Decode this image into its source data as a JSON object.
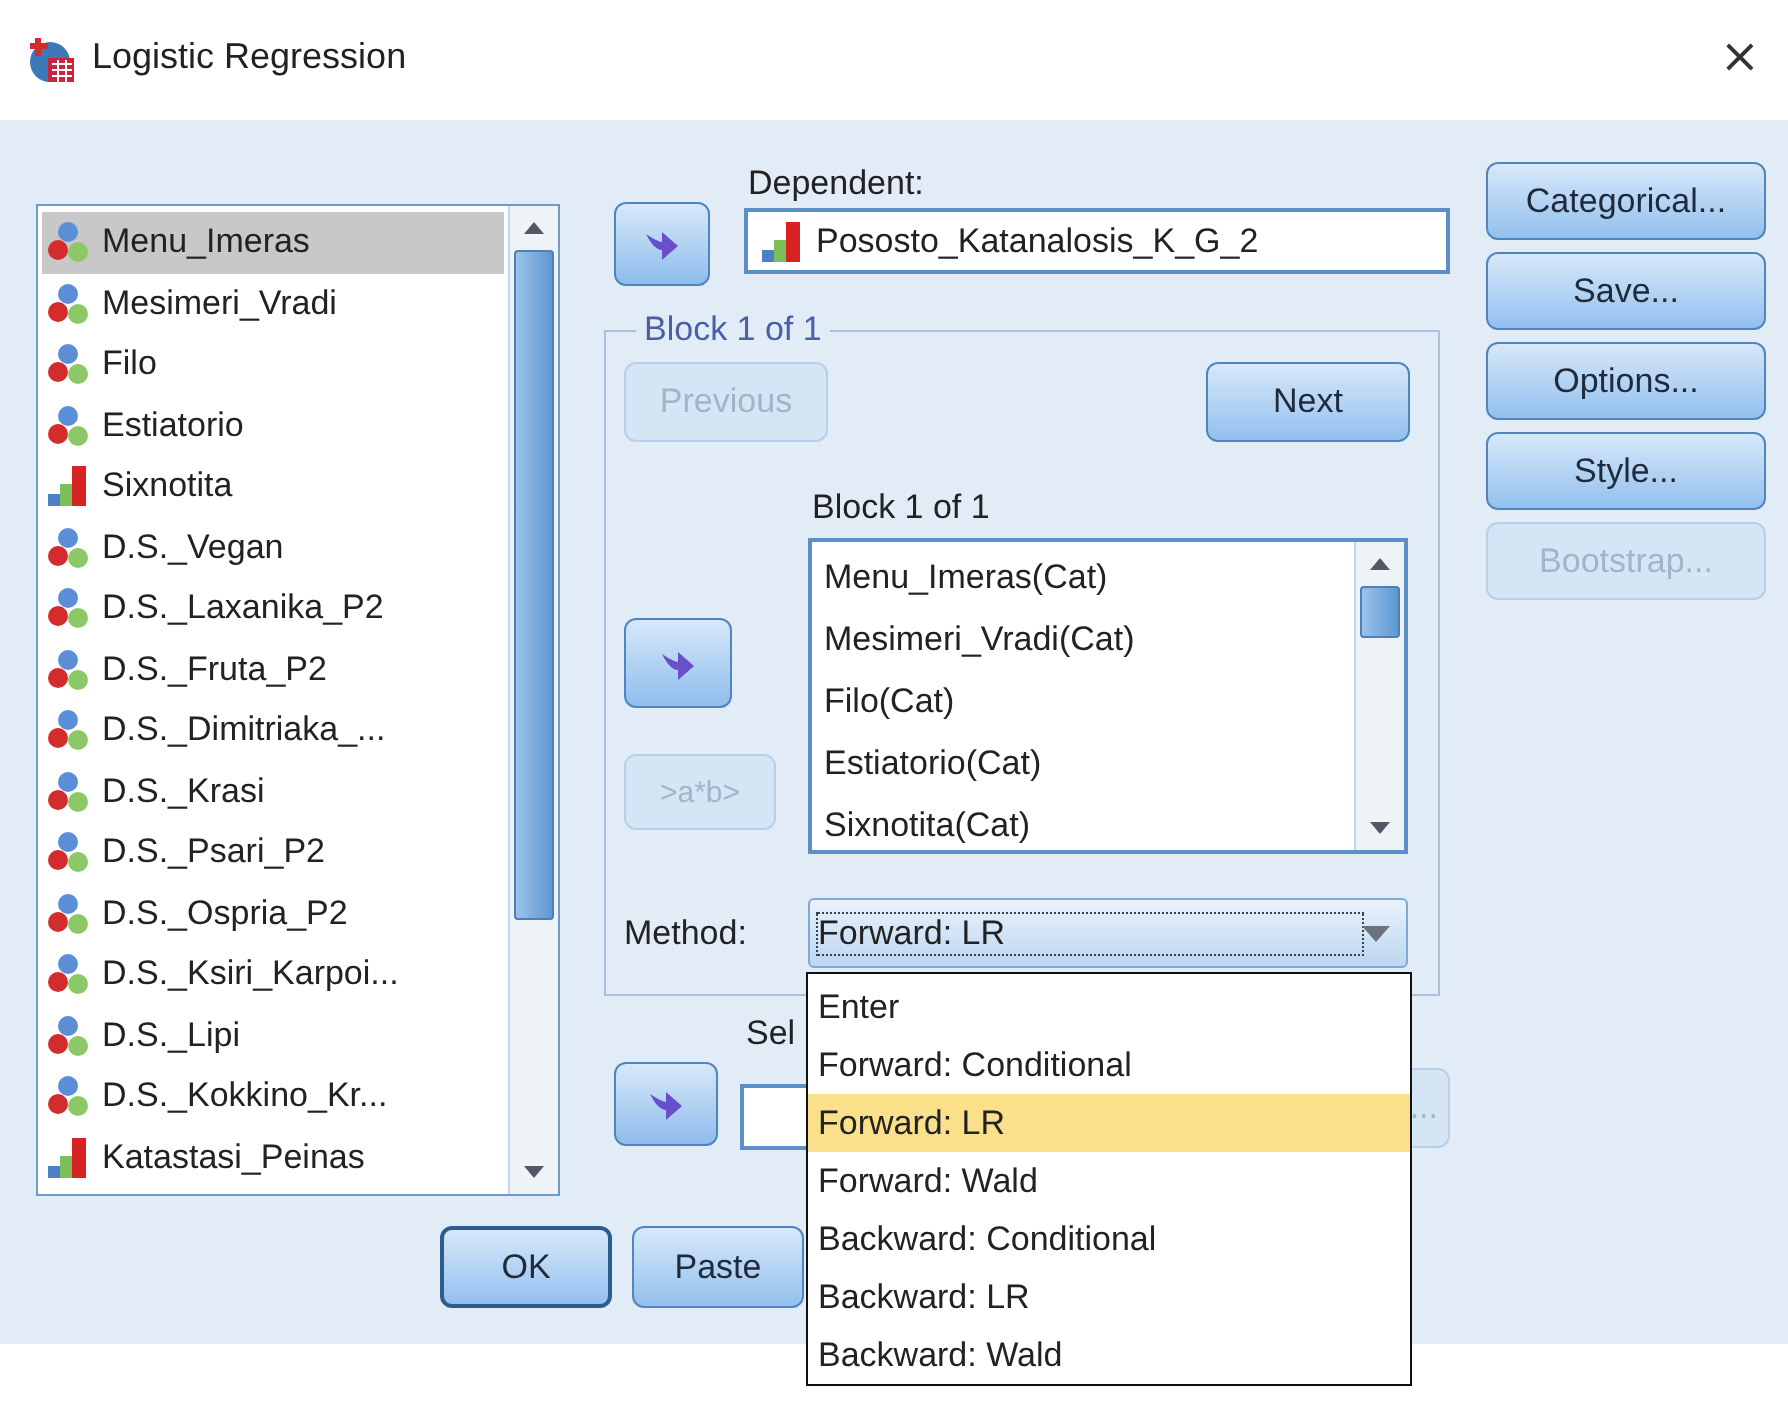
{
  "window": {
    "title": "Logistic Regression",
    "close": "×"
  },
  "variables": [
    {
      "name": "Menu_Imeras",
      "kind": "nominal",
      "selected": true
    },
    {
      "name": "Mesimeri_Vradi",
      "kind": "nominal",
      "selected": false
    },
    {
      "name": "Filo",
      "kind": "nominal",
      "selected": false
    },
    {
      "name": "Estiatorio",
      "kind": "nominal",
      "selected": false
    },
    {
      "name": "Sixnotita",
      "kind": "scale",
      "selected": false
    },
    {
      "name": "D.S._Vegan",
      "kind": "nominal",
      "selected": false
    },
    {
      "name": "D.S._Laxanika_P2",
      "kind": "nominal",
      "selected": false
    },
    {
      "name": "D.S._Fruta_P2",
      "kind": "nominal",
      "selected": false
    },
    {
      "name": "D.S._Dimitriaka_...",
      "kind": "nominal",
      "selected": false
    },
    {
      "name": "D.S._Krasi",
      "kind": "nominal",
      "selected": false
    },
    {
      "name": "D.S._Psari_P2",
      "kind": "nominal",
      "selected": false
    },
    {
      "name": "D.S._Ospria_P2",
      "kind": "nominal",
      "selected": false
    },
    {
      "name": "D.S._Ksiri_Karpoi...",
      "kind": "nominal",
      "selected": false
    },
    {
      "name": "D.S._Lipi",
      "kind": "nominal",
      "selected": false
    },
    {
      "name": "D.S._Kokkino_Kr...",
      "kind": "nominal",
      "selected": false
    },
    {
      "name": "Katastasi_Peinas",
      "kind": "scale",
      "selected": false
    }
  ],
  "dependent": {
    "label": "Dependent:",
    "value": "Pososto_Katanalosis_K_G_2",
    "kind": "scale"
  },
  "block": {
    "legend": "Block 1 of 1",
    "previous": {
      "label": "Previous",
      "disabled": true
    },
    "next": {
      "label": "Next",
      "disabled": false
    },
    "label": "Block 1 of 1",
    "interaction": {
      "label": ">a*b>",
      "disabled": true
    },
    "covariates": [
      "Menu_Imeras(Cat)",
      "Mesimeri_Vradi(Cat)",
      "Filo(Cat)",
      "Estiatorio(Cat)",
      "Sixnotita(Cat)"
    ]
  },
  "method": {
    "label": "Method:",
    "value": "Forward: LR",
    "options": [
      {
        "label": "Enter",
        "selected": false
      },
      {
        "label": "Forward: Conditional",
        "selected": false
      },
      {
        "label": "Forward: LR",
        "selected": true
      },
      {
        "label": "Forward: Wald",
        "selected": false
      },
      {
        "label": "Backward: Conditional",
        "selected": false
      },
      {
        "label": "Backward: LR",
        "selected": false
      },
      {
        "label": "Backward: Wald",
        "selected": false
      }
    ]
  },
  "selection": {
    "label": "Sel",
    "rule_button": "..."
  },
  "side_buttons": [
    {
      "label": "Categorical...",
      "disabled": false
    },
    {
      "label": "Save...",
      "disabled": false
    },
    {
      "label": "Options...",
      "disabled": false
    },
    {
      "label": "Style...",
      "disabled": false
    },
    {
      "label": "Bootstrap...",
      "disabled": true
    }
  ],
  "bottom_buttons": [
    {
      "label": "OK"
    },
    {
      "label": "Paste"
    }
  ]
}
